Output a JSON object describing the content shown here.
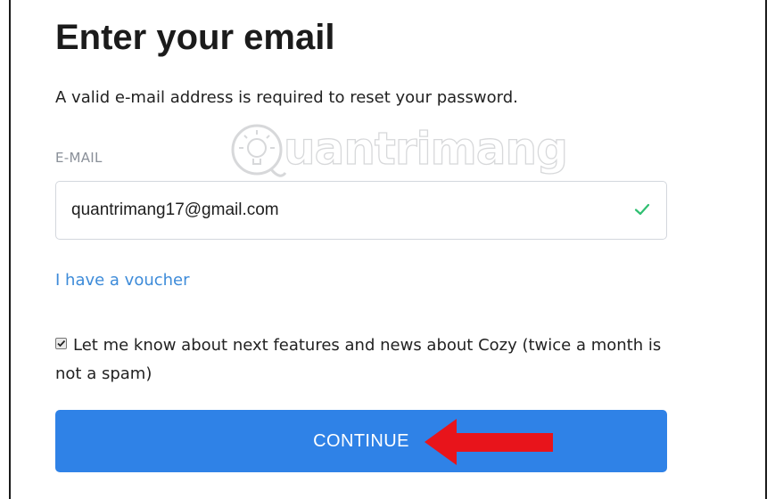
{
  "page": {
    "title": "Enter your email",
    "description": "A valid e-mail address is required to reset your password."
  },
  "email_field": {
    "label": "E-MAIL",
    "value": "quantrimang17@gmail.com",
    "valid": true
  },
  "voucher_link": {
    "label": "I have a voucher"
  },
  "newsletter": {
    "checked": true,
    "label": "Let me know about next features and news about Cozy (twice a month is not a spam)"
  },
  "continue_button": {
    "label": "CONTINUE"
  },
  "watermark": {
    "text": "uantrimang"
  },
  "icons": {
    "valid": "check-icon",
    "watermark_logo": "bulb-icon",
    "annotation": "red-arrow-icon"
  },
  "colors": {
    "primary_button": "#2f82e7",
    "link": "#3d8bd9",
    "valid_check": "#2fbf71",
    "annotation_arrow": "#e8141b"
  }
}
